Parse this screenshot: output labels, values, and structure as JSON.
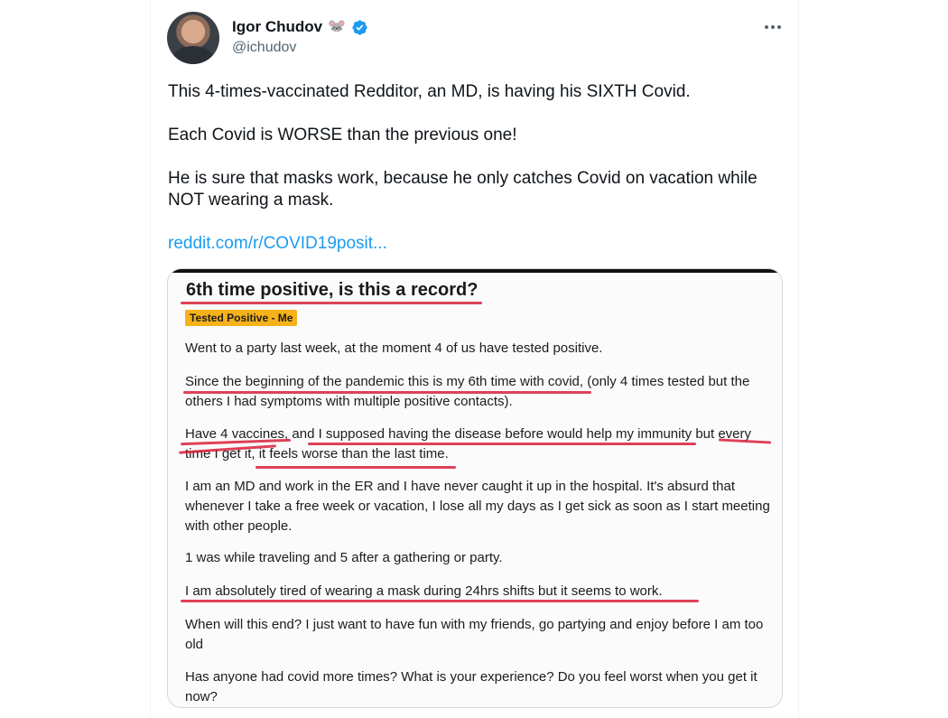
{
  "author": {
    "display_name": "Igor Chudov",
    "emoji": "🐭",
    "handle": "@ichudov"
  },
  "icons": {
    "more": "more-options-icon",
    "verified": "verified-badge-icon",
    "avatar": "user-avatar"
  },
  "colors": {
    "link": "#1d9bf0",
    "verified": "#1d9bf0",
    "flair": "#f6b21a",
    "annotation": "#d8203a"
  },
  "tweet": {
    "paragraphs": [
      "This 4-times-vaccinated Redditor, an MD, is having his SIXTH Covid.",
      "Each Covid is WORSE than the previous one!",
      "He is sure that masks work, because he only catches Covid on vacation while NOT wearing a mask."
    ],
    "link": "reddit.com/r/COVID19posit..."
  },
  "reddit_post": {
    "title": "6th time positive, is this a record?",
    "flair": "Tested Positive - Me",
    "body": [
      "Went to a party last week, at the moment 4 of us have tested positive.",
      "Since the beginning of the pandemic this is my 6th time with covid, (only 4 times tested but the others I had symptoms with multiple positive contacts).",
      "Have 4 vaccines, and I supposed having the disease before would help my immunity but every time I get it, it feels worse than the last time.",
      "I am an MD and work in the ER and I have never caught it up in the hospital. It's absurd that whenever I take a free week or vacation, I lose all my days as I get sick as soon as I start meeting with other people.",
      "1 was while traveling and 5 after a gathering or party.",
      "I am absolutely tired of wearing a mask during 24hrs shifts but it seems to work.",
      "When will this end? I just want to have fun with my friends, go partying and enjoy before I am too old",
      "Has anyone had covid more times? What is your experience? Do you feel worst when you get it now?"
    ]
  }
}
